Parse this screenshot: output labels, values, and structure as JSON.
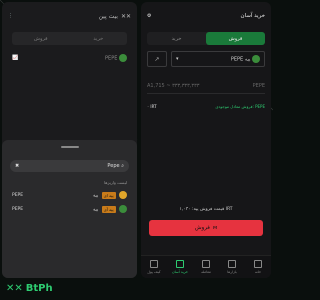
{
  "left": {
    "brand": "بیت پین",
    "tabs": [
      "فروش",
      "خرید"
    ],
    "coin_label": "PEPE",
    "search_value": "Pepe",
    "list_header": "لیست واریزها",
    "rows": [
      {
        "symbol": "PEPE",
        "name": "پپه",
        "badge": "پپه ای"
      },
      {
        "symbol": "PEPE",
        "name": "پپه",
        "badge": "پپه آی"
      }
    ]
  },
  "right": {
    "title": "خرید آسان",
    "tabs": [
      "خرید",
      "فروش"
    ],
    "active_tab": 1,
    "select_value": "PEPE پپه",
    "amount_right": "PEPE",
    "amount_left": "A1,715 ~ ۳۳۳,۳۳۳,۳۳۳",
    "balance_label": "فروش معادل موجودی: PEPE",
    "balance_value": "۰ IRT",
    "price_text": "قیمت فروش پپه: ۱,۰۳۰ IRT",
    "sell_label": "فروش",
    "nav": [
      "خانه",
      "بازارها",
      "معامله",
      "خرید آسان",
      "کیف پول"
    ],
    "nav_active": 3
  },
  "logo_text": "BtPh",
  "colors": {
    "accent": "#2ecc71",
    "sell": "#e6333f",
    "badge": "#c87b1a"
  }
}
